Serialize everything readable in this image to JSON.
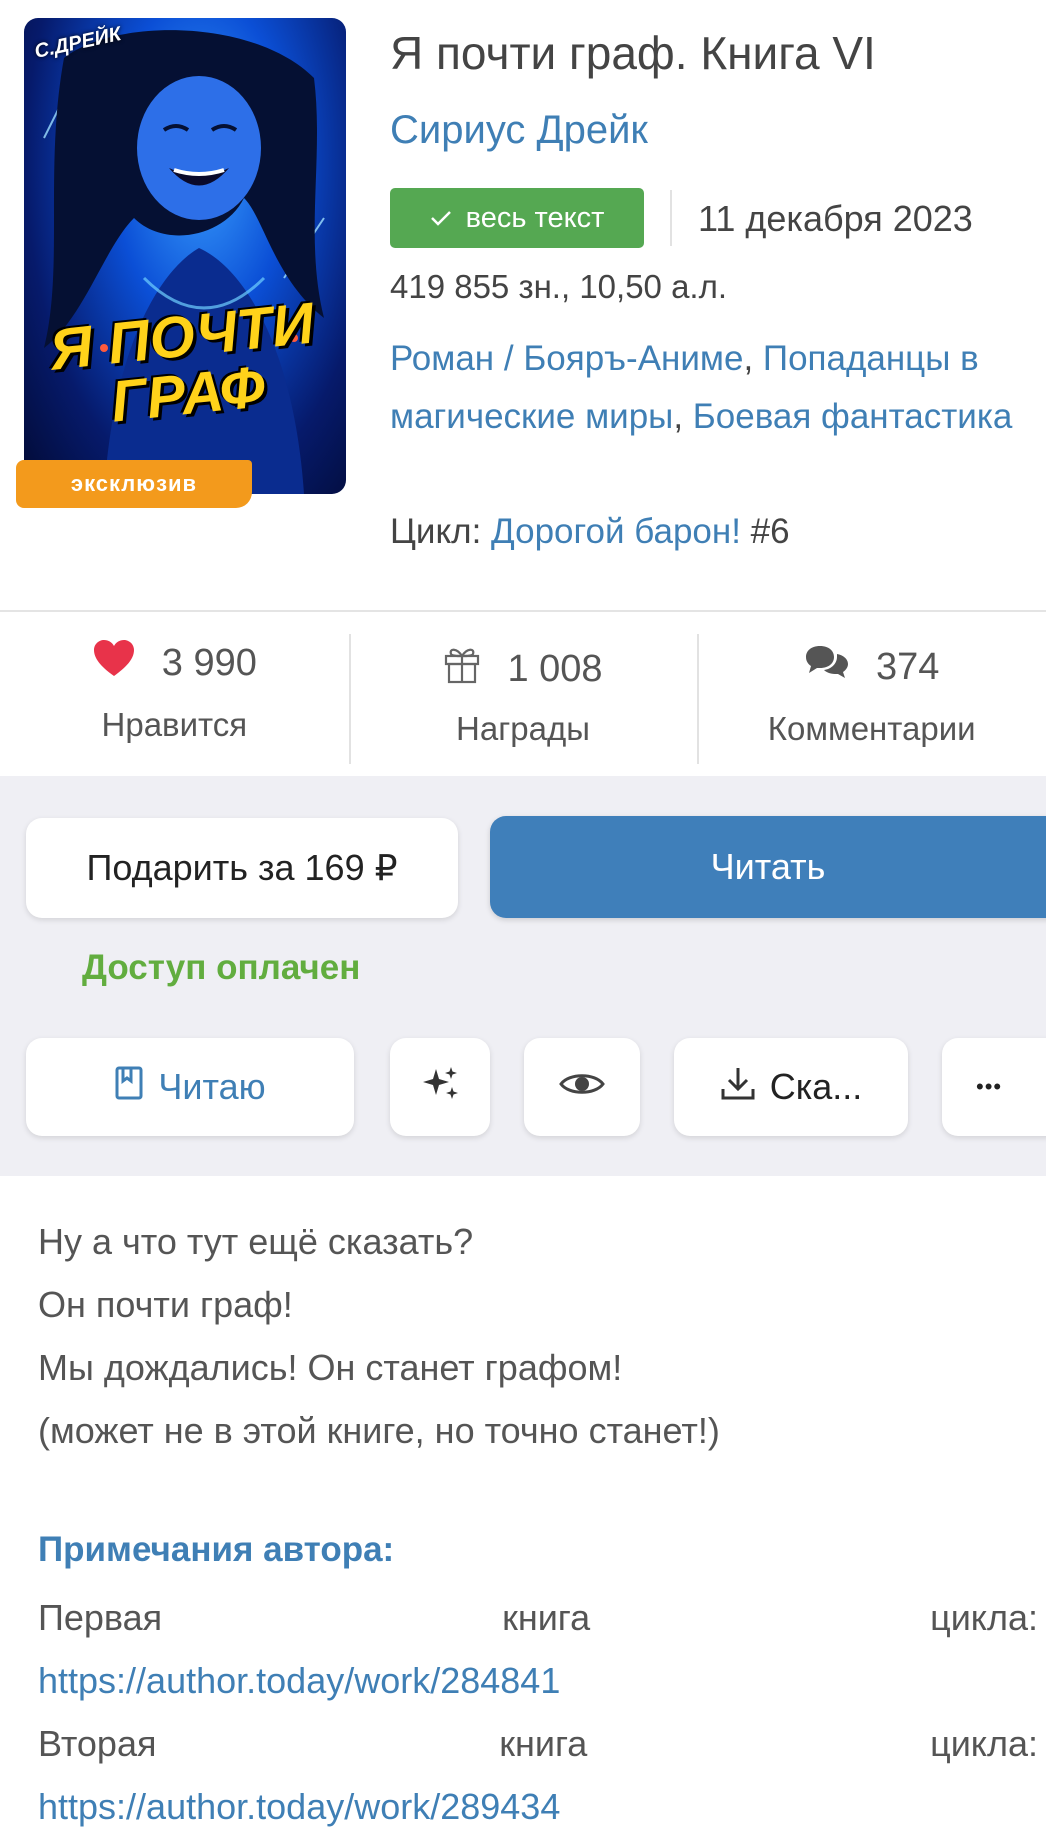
{
  "book": {
    "cover_title": "Я ПОЧТИ ГРАФ",
    "cover_author": "С.ДРЕЙК",
    "cover_badge": "эксклюзив",
    "title": "Я почти граф. Книга VI",
    "author": "Сириус Дрейк",
    "status": "весь текст",
    "date": "11 декабря 2023",
    "size": "419 855 зн., 10,50 а.л.",
    "genres": {
      "g1": "Роман",
      "slash": " / ",
      "g2": "Бояръ-Аниме",
      "comma1": ", ",
      "g3": "Попаданцы в магические миры",
      "comma2": ", ",
      "g4": "Боевая фантастика"
    },
    "cycle_label": "Цикл: ",
    "cycle_name": "Дорогой барон!",
    "cycle_num": " #6"
  },
  "stats": {
    "likes": {
      "value": "3 990",
      "label": "Нравится"
    },
    "awards": {
      "value": "1 008",
      "label": "Награды"
    },
    "comments": {
      "value": "374",
      "label": "Комментарии"
    }
  },
  "actions": {
    "gift_label": "Подарить за 169 ₽",
    "read_label": "Читать",
    "paid_status": "Доступ оплачен",
    "reading_label": "Читаю",
    "download_label": "Ска...",
    "more_label": "•••"
  },
  "description": {
    "lines": [
      "Ну а что тут ещё сказать?",
      "Он почти граф!",
      "Мы дождались! Он станет графом!",
      "(может не в этой книге, но точно станет!)"
    ],
    "notes_title": "Примечания автора:",
    "note1": {
      "w1": "Первая",
      "w2": "книга",
      "w3": "цикла:",
      "link": "https://author.today/work/284841"
    },
    "note2": {
      "w1": "Вторая",
      "w2": "книга",
      "w3": "цикла:",
      "link": "https://author.today/work/289434"
    }
  },
  "colors": {
    "link": "#3f7fb5",
    "status_green": "#55a852",
    "paid_green": "#62ad3f",
    "primary_button": "#3f7fba",
    "badge_orange": "#f39a1c",
    "heart": "#e8334a"
  },
  "icons": {
    "status": "checkmark-icon",
    "likes": "heart-icon",
    "awards": "gift-icon",
    "comments": "comments-icon",
    "reading": "bookmark-icon",
    "ai": "sparkles-icon",
    "watch": "eye-icon",
    "download": "download-icon"
  }
}
